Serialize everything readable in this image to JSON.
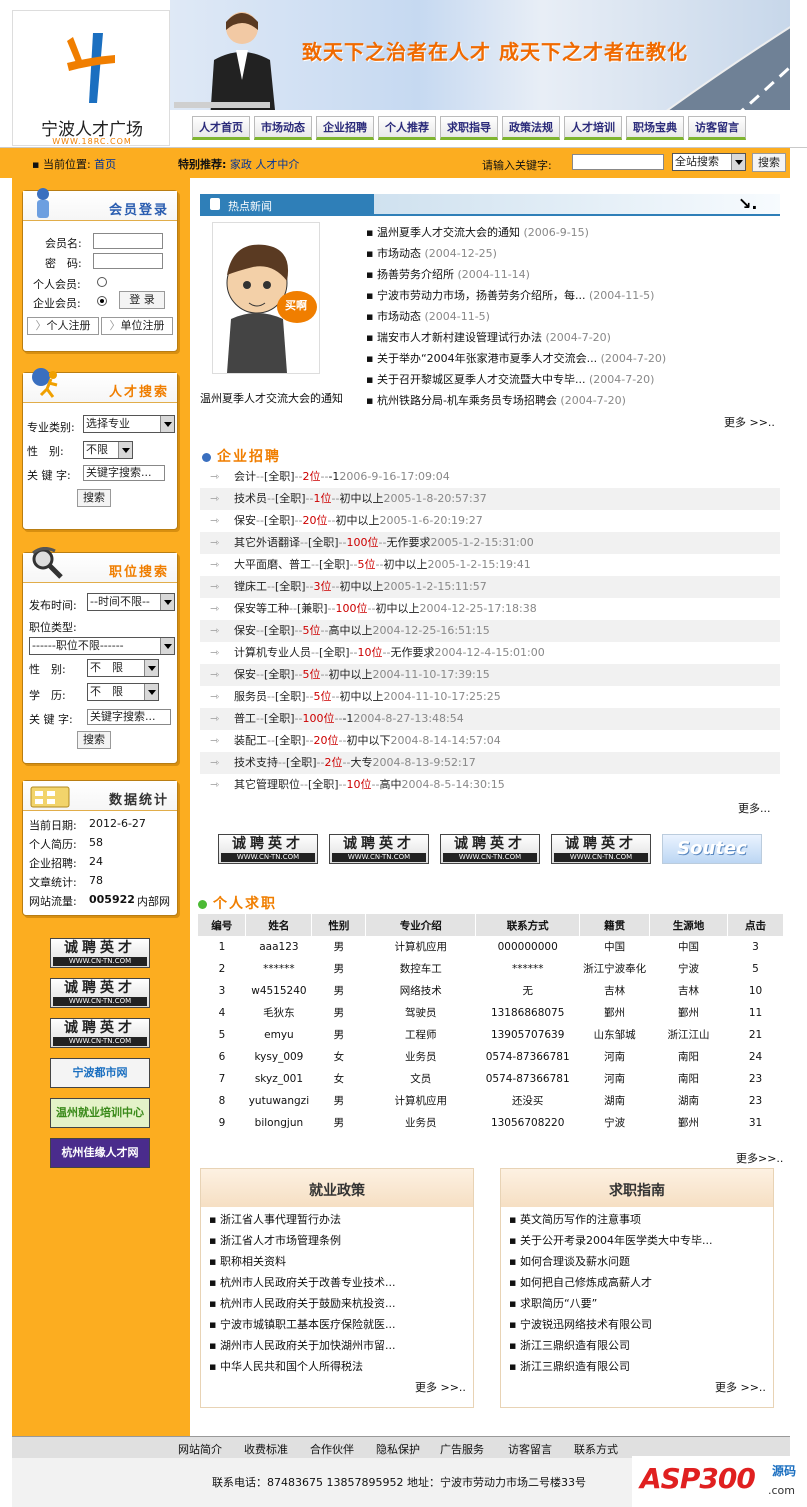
{
  "header": {
    "site_name": "宁波人才广场",
    "site_domain": "WWW.18RC.COM",
    "slogan": "致天下之治者在人才 成天下之才者在教化",
    "nav": [
      "人才首页",
      "市场动态",
      "企业招聘",
      "个人推荐",
      "求职指导",
      "政策法规",
      "人才培训",
      "职场宝典",
      "访客留言"
    ]
  },
  "crumb": {
    "label": "当前位置:",
    "home": "首页",
    "special_label": "特别推荐:",
    "special_links": [
      "家政",
      "人才中介"
    ]
  },
  "search": {
    "label": "请输入关键字:",
    "scope": "全站搜索",
    "button": "搜索"
  },
  "login": {
    "title": "会员登录",
    "user_label": "会员名:",
    "pass_label": "密　码:",
    "personal": "个人会员:",
    "company": "企业会员:",
    "login_btn": "登 录",
    "reg_personal": "个人注册",
    "reg_company": "单位注册"
  },
  "talent_search": {
    "title": "人才搜索",
    "major_label": "专业类别:",
    "major_value": "选择专业",
    "gender_label": "性　别:",
    "gender_value": "不限",
    "kw_label": "关 键 字:",
    "kw_value": "关键字搜索...",
    "button": "搜索"
  },
  "job_search": {
    "title": "职位搜索",
    "time_label": "发布时间:",
    "time_value": "--时间不限--",
    "type_label": "职位类型:",
    "type_value": "------职位不限------",
    "gender_label": "性　别:",
    "gender_value": "不　限",
    "edu_label": "学　历:",
    "edu_value": "不　限",
    "kw_label": "关 键 字:",
    "kw_value": "关键字搜索...",
    "button": "搜索"
  },
  "stats": {
    "title": "数据统计",
    "rows": [
      {
        "label": "当前日期:",
        "value": "2012-6-27"
      },
      {
        "label": "个人简历:",
        "value": "58"
      },
      {
        "label": "企业招聘:",
        "value": "24"
      },
      {
        "label": "文章统计:",
        "value": "78"
      },
      {
        "label": "网站流量:",
        "value": "005922",
        "suffix": "内部网"
      }
    ]
  },
  "side_logos": [
    "诚聘英才",
    "诚聘英才",
    "诚聘英才",
    "宁波都市网",
    "温州就业培训中心",
    "杭州佳缘人才网"
  ],
  "logo_sub": "WWW.CN-TN.COM",
  "news": {
    "title": "热点新闻",
    "caption": "温州夏季人才交流大会的通知",
    "badge": "买啊",
    "more": "更多 >>..",
    "items": [
      {
        "t": "温州夏季人才交流大会的通知",
        "d": "(2006-9-15)"
      },
      {
        "t": "市场动态",
        "d": "(2004-12-25)"
      },
      {
        "t": "扬善劳务介绍所",
        "d": "(2004-11-14)"
      },
      {
        "t": "宁波市劳动力市场，扬善劳务介绍所，每...",
        "d": "(2004-11-5)"
      },
      {
        "t": "市场动态",
        "d": "(2004-11-5)"
      },
      {
        "t": "瑞安市人才新村建设管理试行办法",
        "d": "(2004-7-20)"
      },
      {
        "t": "关于举办“2004年张家港市夏季人才交流会...",
        "d": "(2004-7-20)"
      },
      {
        "t": "关于召开黎城区夏季人才交流暨大中专毕...",
        "d": "(2004-7-20)"
      },
      {
        "t": "杭州铁路分局-机车乘务员专场招聘会",
        "d": "(2004-7-20)"
      }
    ]
  },
  "jobs": {
    "title": "企业招聘",
    "more": "更多...",
    "items": [
      {
        "t": "会计",
        "type": "[全职]",
        "n": "2位",
        "req": "-1",
        "d": "2006-9-16-17:09:04"
      },
      {
        "t": "技术员",
        "type": "[全职]",
        "n": "1位",
        "req": "初中以上",
        "d": "2005-1-8-20:57:37"
      },
      {
        "t": "保安",
        "type": "[全职]",
        "n": "20位",
        "req": "初中以上",
        "d": "2005-1-6-20:19:27"
      },
      {
        "t": "其它外语翻译",
        "type": "[全职]",
        "n": "100位",
        "req": "无作要求",
        "d": "2005-1-2-15:31:00"
      },
      {
        "t": "大平面磨、普工",
        "type": "[全职]",
        "n": "5位",
        "req": "初中以上",
        "d": "2005-1-2-15:19:41"
      },
      {
        "t": "镗床工",
        "type": "[全职]",
        "n": "3位",
        "req": "初中以上",
        "d": "2005-1-2-15:11:57"
      },
      {
        "t": "保安等工种",
        "type": "[兼职]",
        "n": "100位",
        "req": "初中以上",
        "d": "2004-12-25-17:18:38"
      },
      {
        "t": "保安",
        "type": "[全职]",
        "n": "5位",
        "req": "高中以上",
        "d": "2004-12-25-16:51:15"
      },
      {
        "t": "计算机专业人员",
        "type": "[全职]",
        "n": "10位",
        "req": "无作要求",
        "d": "2004-12-4-15:01:00"
      },
      {
        "t": "保安",
        "type": "[全职]",
        "n": "5位",
        "req": "初中以上",
        "d": "2004-11-10-17:39:15"
      },
      {
        "t": "服务员",
        "type": "[全职]",
        "n": "5位",
        "req": "初中以上",
        "d": "2004-11-10-17:25:25"
      },
      {
        "t": "普工",
        "type": "[全职]",
        "n": "100位",
        "req": "-1",
        "d": "2004-8-27-13:48:54"
      },
      {
        "t": "装配工",
        "type": "[全职]",
        "n": "20位",
        "req": "初中以下",
        "d": "2004-8-14-14:57:04"
      },
      {
        "t": "技术支持",
        "type": "[全职]",
        "n": "2位",
        "req": "大专",
        "d": "2004-8-13-9:52:17"
      },
      {
        "t": "其它管理职位",
        "type": "[全职]",
        "n": "10位",
        "req": "高中",
        "d": "2004-8-5-14:30:15"
      }
    ]
  },
  "mid_logos": [
    "诚聘英才",
    "诚聘英才",
    "诚聘英才",
    "诚聘英才",
    "Soutec"
  ],
  "persons": {
    "title": "个人求职",
    "more": "更多>>..",
    "headers": [
      "编号",
      "姓名",
      "性别",
      "专业介绍",
      "联系方式",
      "籍贯",
      "生源地",
      "点击"
    ],
    "rows": [
      [
        "1",
        "aaa123",
        "男",
        "计算机应用",
        "000000000",
        "中国",
        "中国",
        "3"
      ],
      [
        "2",
        "******",
        "男",
        "数控车工",
        "******",
        "浙江宁波奉化",
        "宁波",
        "5"
      ],
      [
        "3",
        "w4515240",
        "男",
        "网络技术",
        "无",
        "吉林",
        "吉林",
        "10"
      ],
      [
        "4",
        "毛狄东",
        "男",
        "驾驶员",
        "13186868075",
        "鄞州",
        "鄞州",
        "11"
      ],
      [
        "5",
        "emyu",
        "男",
        "工程师",
        "13905707639",
        "山东邹城",
        "浙江江山",
        "21"
      ],
      [
        "6",
        "kysy_009",
        "女",
        "业务员",
        "0574-87366781",
        "河南",
        "南阳",
        "24"
      ],
      [
        "7",
        "skyz_001",
        "女",
        "文员",
        "0574-87366781",
        "河南",
        "南阳",
        "23"
      ],
      [
        "8",
        "yutuwangzi",
        "男",
        "计算机应用",
        "还没买",
        "湖南",
        "湖南",
        "23"
      ],
      [
        "9",
        "bilongjun",
        "男",
        "业务员",
        "13056708220",
        "宁波",
        "鄞州",
        "31"
      ]
    ]
  },
  "policy": {
    "title": "就业政策",
    "more": "更多 >>..",
    "items": [
      "浙江省人事代理暂行办法",
      "浙江省人才市场管理条例",
      "职称相关资料",
      "杭州市人民政府关于改善专业技术...",
      "杭州市人民政府关于鼓励来杭投资...",
      "宁波市城镇职工基本医疗保险就医...",
      "湖州市人民政府关于加快湖州市留...",
      "中华人民共和国个人所得税法"
    ]
  },
  "guide": {
    "title": "求职指南",
    "more": "更多 >>..",
    "items": [
      "英文简历写作的注意事项",
      "关于公开考录2004年医学类大中专毕...",
      "如何合理谈及薪水问题",
      "如何把自己修炼成高薪人才",
      "求职简历“八要”",
      "宁波锐迅网络技术有限公司",
      "浙江三鼎织造有限公司",
      "浙江三鼎织造有限公司"
    ]
  },
  "footer": {
    "links": [
      "网站简介",
      "收费标准",
      "合作伙伴",
      "隐私保护",
      "广告服务",
      "访客留言",
      "联系方式"
    ],
    "contact": "联系电话：87483675 13857895952 地址：宁波市劳动力市场二号楼33号",
    "asp_logo": "ASP300",
    "asp_sub": "源码",
    "asp_dom": ".com"
  },
  "colors": {
    "accent": "#fcad20",
    "brand_orange": "#f07e00",
    "link": "#003399",
    "num_red": "#cc0000"
  }
}
